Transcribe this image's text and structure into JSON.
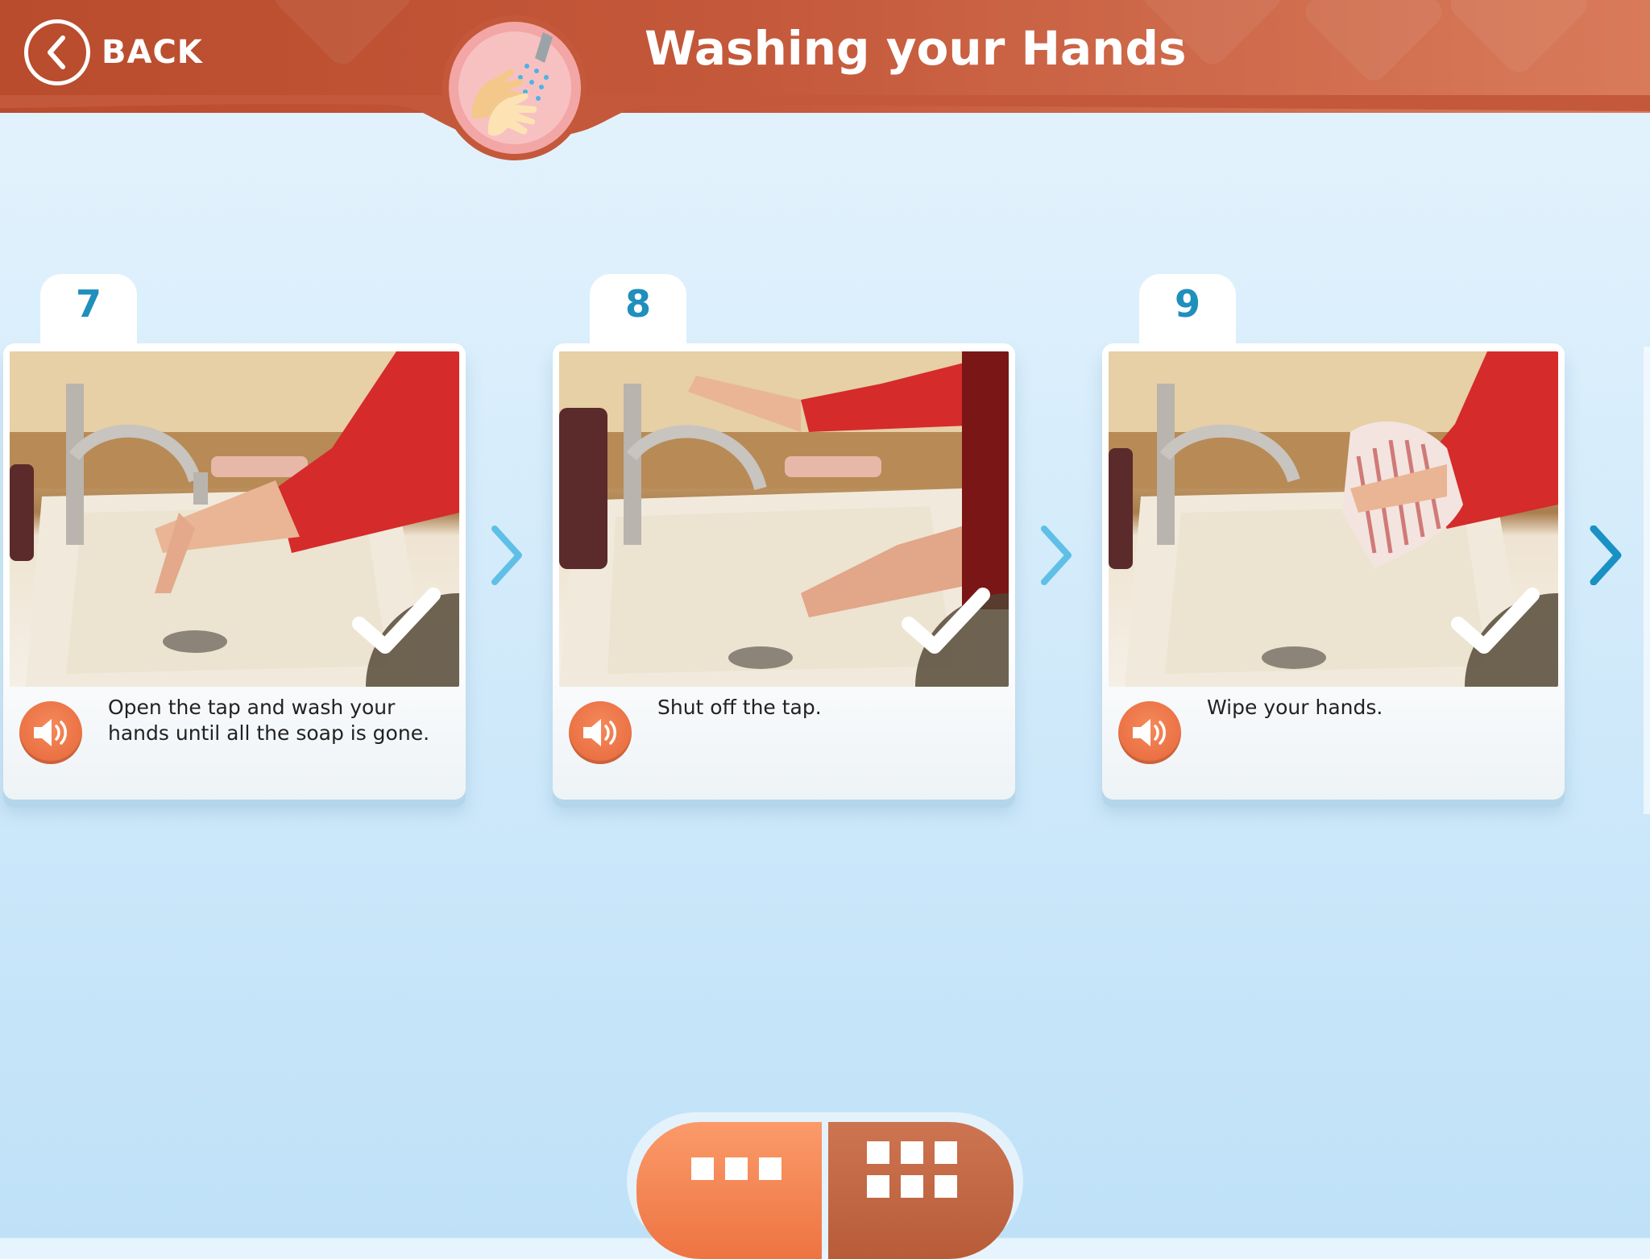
{
  "header": {
    "back_label": "BACK",
    "title": "Washing your Hands"
  },
  "steps": [
    {
      "number": "7",
      "caption": "Open the tap and wash your hands until all the soap is gone.",
      "completed": true
    },
    {
      "number": "8",
      "caption": "Shut off the tap.",
      "completed": true
    },
    {
      "number": "9",
      "caption": "Wipe your hands.",
      "completed": true
    }
  ],
  "colors": {
    "header": "#c4583a",
    "accent_blue": "#1f8fbd",
    "audio": "#ee7442",
    "toggle_active": "#ee7442",
    "toggle_inactive": "#b85c38"
  },
  "icons": {
    "back": "chevron-left-icon",
    "audio": "speaker-icon",
    "done": "checkmark-icon",
    "next": "chevron-right-icon",
    "view_strip": "three-squares-icon",
    "view_grid": "grid-icon"
  }
}
